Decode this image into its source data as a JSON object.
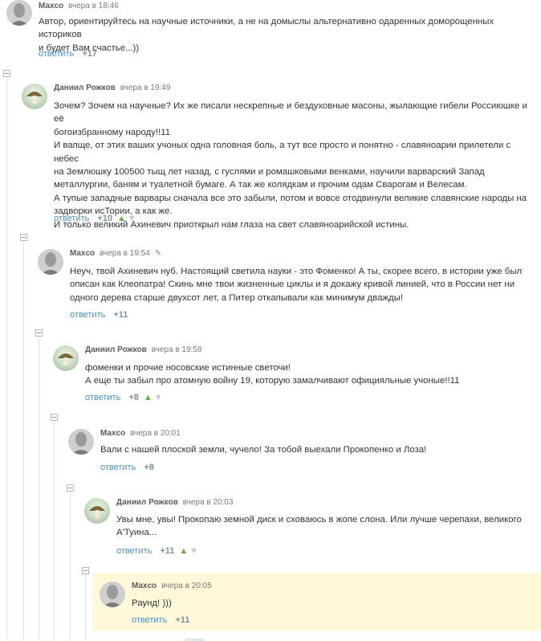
{
  "comments": [
    {
      "author": "Maxco",
      "date": "вчера в 18:46",
      "lines": [
        "Автор, ориентируйтесь на научные источники, а не на домыслы альтернативно одаренных доморощенных историков",
        "и будет Вам счастье...))"
      ],
      "reply": "ответить",
      "score": "+17"
    },
    {
      "author": "Даниил Рожков",
      "date": "вчера в 19:49",
      "lines": [
        "Зочем? Зочем на научные? Их же писали нескрепные и бездуховные масоны, жылающие гибели Россиюшке и её",
        "богоизбранному народу!!11",
        "И вапще, от этих ваших учоных одна головная боль, а тут все просто и понятно - славяноарии прилетели с небес",
        "на Землюшку 100500 тыщ лет назад, с гуслями и ромашковыми венками, научили варварский Запад",
        "металлургии, баням и туалетной бумаге. А так же колядкам и прочим одам Сварогам и Велесам.",
        "А тупые западные варвары сначала все это забыли, потом и вовсе отодвинули великие славянские народы на",
        "задворки исТории, а как же.",
        "И только великий Ахиневич приоткрыл нам глаза на свет славяноарийской истины."
      ],
      "reply": "ответить",
      "score": "+10"
    },
    {
      "author": "Maxco",
      "date": "вчера в 19:54",
      "lines": [
        "Неуч, твой Ахиневич нуб. Настоящий светила науки - это Фоменко! А ты, скорее всего, в истории уже был",
        "описан как Клеопатра! Скинь мне твои жизненные циклы и я докажу кривой линией, что в России нет ни",
        "одного дерева старше двухсот лет, а Питер откапывали как минимум дважды!"
      ],
      "reply": "ответить",
      "score": "+11"
    },
    {
      "author": "Даниил Рожков",
      "date": "вчера в 19:58",
      "lines": [
        "фоменки и прочие носовские истинные светочи!",
        "А еще ты забыл про атомную войну 19, которую замалчивают официяльные учоные!!11"
      ],
      "reply": "ответить",
      "score": "+8"
    },
    {
      "author": "Maxco",
      "date": "вчера в 20:01",
      "lines": [
        "Вали с нашей плоской земли, чучело! За тобой выехали Прокопенко и Лоза!"
      ],
      "reply": "ответить",
      "score": "+8"
    },
    {
      "author": "Даниил Рожков",
      "date": "вчера в 20:03",
      "lines": [
        "Увы мне, увы! Прокопаю земной диск и сховаюсь в жопе слона. Или лучше черепахи, великого",
        "А'Туина..."
      ],
      "reply": "ответить",
      "score": "+11"
    },
    {
      "author": "Maxco",
      "date": "вчера в 20:05",
      "lines": [
        "Раунд! )))"
      ],
      "reply": "ответить",
      "score": "+11"
    }
  ],
  "icons": {
    "vote_up": "thumbs-up-icon",
    "vote_down": "thumbs-down-icon",
    "edit": "pencil-icon",
    "collapse": "collapse-toggle-icon"
  },
  "colors": {
    "reply_link": "#4a8fc4",
    "score": "#7e8fa0",
    "vote_up": "#6bb24a",
    "highlight": "#fff8d9"
  }
}
